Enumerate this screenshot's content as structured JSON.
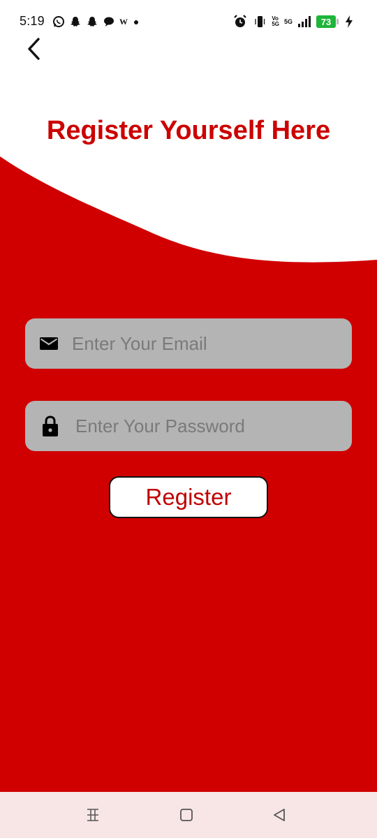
{
  "status_bar": {
    "time": "5:19",
    "notification_icons": [
      "whatsapp-icon",
      "snapchat-icon",
      "snapchat-icon",
      "chat-bubble-icon",
      "wifi-calling-icon",
      "dot-icon"
    ],
    "wifi_label": "W",
    "volte_top": "Vo",
    "volte_bottom": "5G",
    "network_label": "5G",
    "battery_level": "73",
    "battery_color": "#1fb43a"
  },
  "header": {
    "back_icon": "chevron-left-icon",
    "title": "Register Yourself Here"
  },
  "form": {
    "email": {
      "icon": "mail-icon",
      "placeholder": "Enter Your Email",
      "value": ""
    },
    "password": {
      "icon": "lock-icon",
      "placeholder": "Enter Your Password",
      "value": ""
    },
    "register_label": "Register"
  },
  "nav_bar": {
    "recents_icon": "recents-icon",
    "home_icon": "home-icon",
    "back_icon": "back-triangle-icon"
  },
  "colors": {
    "primary_red": "#d00000",
    "title_red": "#cc0000",
    "input_gray": "#b4b4b4",
    "nav_bg": "#f8e6e6"
  }
}
